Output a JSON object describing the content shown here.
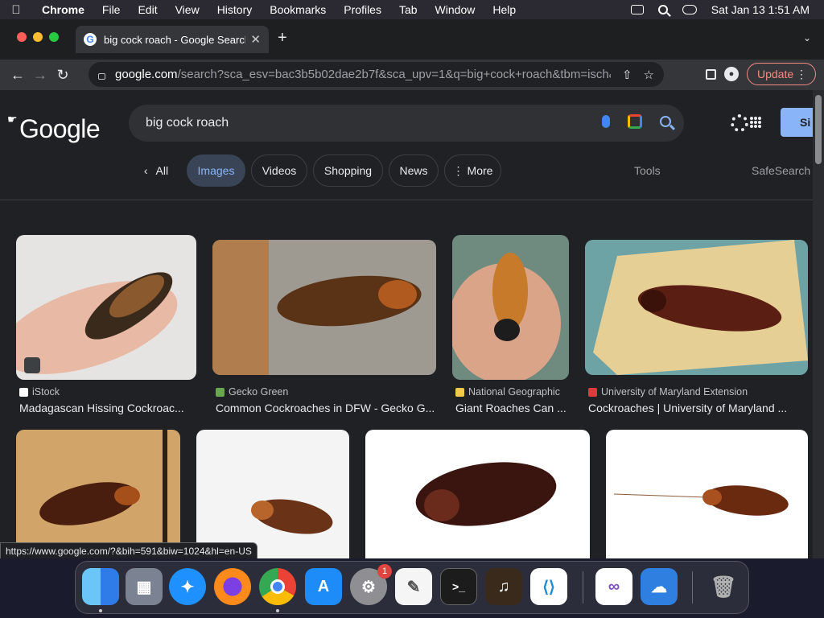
{
  "menubar": {
    "app_name": "Chrome",
    "items": [
      "File",
      "Edit",
      "View",
      "History",
      "Bookmarks",
      "Profiles",
      "Tab",
      "Window",
      "Help"
    ],
    "datetime": "Sat Jan 13  1:51 AM"
  },
  "browser": {
    "tab_title": "big cock roach - Google Search",
    "url_host": "google.com",
    "url_path": "/search?sca_esv=bac3b5b02dae2b7f&sca_upv=1&q=big+cock+roach&tbm=isch&s...",
    "update_label": "Update"
  },
  "google": {
    "logo": "Google",
    "query": "big cock roach",
    "signin_label": "Si",
    "chips": [
      "All",
      "Images",
      "Videos",
      "Shopping",
      "News",
      "More"
    ],
    "tools_label": "Tools",
    "safesearch_label": "SafeSearch"
  },
  "results": [
    {
      "source": "iStock",
      "title": "Madagascan Hissing Cockroac...",
      "favicon_color": "#ffffff"
    },
    {
      "source": "Gecko Green",
      "title": "Common Cockroaches in DFW - Gecko G...",
      "favicon_color": "#6aa84f"
    },
    {
      "source": "National Geographic",
      "title": "Giant Roaches Can ...",
      "favicon_color": "#f2c94c"
    },
    {
      "source": "University of Maryland Extension",
      "title": "Cockroaches | University of Maryland ...",
      "favicon_color": "#e03a3e"
    }
  ],
  "status_url": "https://www.google.com/?&bih=591&biw=1024&hl=en-US",
  "dock": {
    "apps": [
      "Finder",
      "Launchpad",
      "Safari",
      "Firefox",
      "Chrome",
      "App Store",
      "System Settings",
      "TextEdit",
      "Terminal",
      "GarageBand",
      "Visual Studio Code",
      "Visual Studio",
      "Weather",
      "Trash"
    ],
    "settings_badge": "1"
  },
  "colors": {
    "accent": "#8ab4f8",
    "page_bg": "#202124",
    "update_outline": "#f28b82"
  }
}
